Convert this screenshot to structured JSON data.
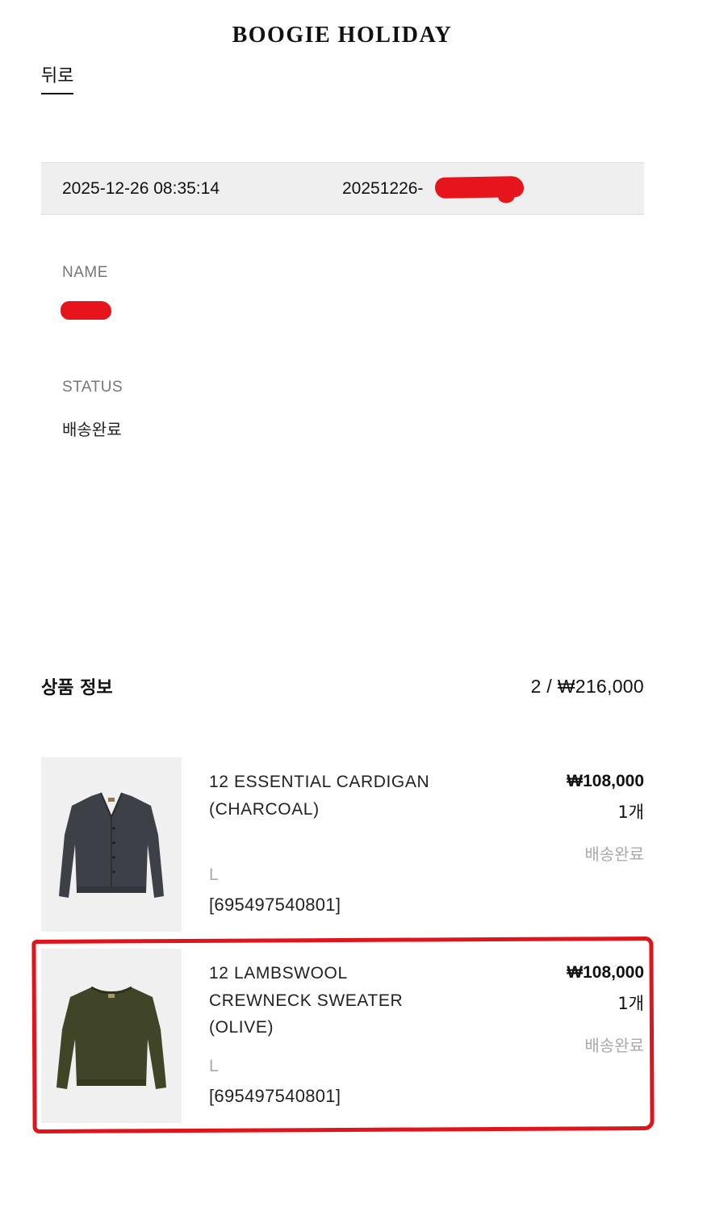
{
  "header": {
    "brand": "BOOGIE HOLIDAY",
    "back_label": "뒤로"
  },
  "order": {
    "date": "2025-12-26 08:35:14",
    "number_prefix": "20251226-"
  },
  "customer": {
    "name_label": "NAME",
    "status_label": "STATUS",
    "status_value": "배송완료"
  },
  "products_section": {
    "title": "상품 정보",
    "summary": "2 / ₩216,000"
  },
  "products": [
    {
      "name": "12 ESSENTIAL CARDIGAN (CHARCOAL)",
      "size": "L",
      "code": "[695497540801]",
      "price": "₩108,000",
      "quantity": "1개",
      "status": "배송완료",
      "image": "cardigan-charcoal",
      "color": "#3e4048"
    },
    {
      "name": "12 LAMBSWOOL CREWNECK SWEATER (OLIVE)",
      "size": "L",
      "code": "[695497540801]",
      "price": "₩108,000",
      "quantity": "1개",
      "status": "배송완료",
      "image": "sweater-olive",
      "color": "#3f4526"
    }
  ],
  "annotations": {
    "redaction_color": "#e8141b",
    "highlight_color": "#e0141b"
  }
}
